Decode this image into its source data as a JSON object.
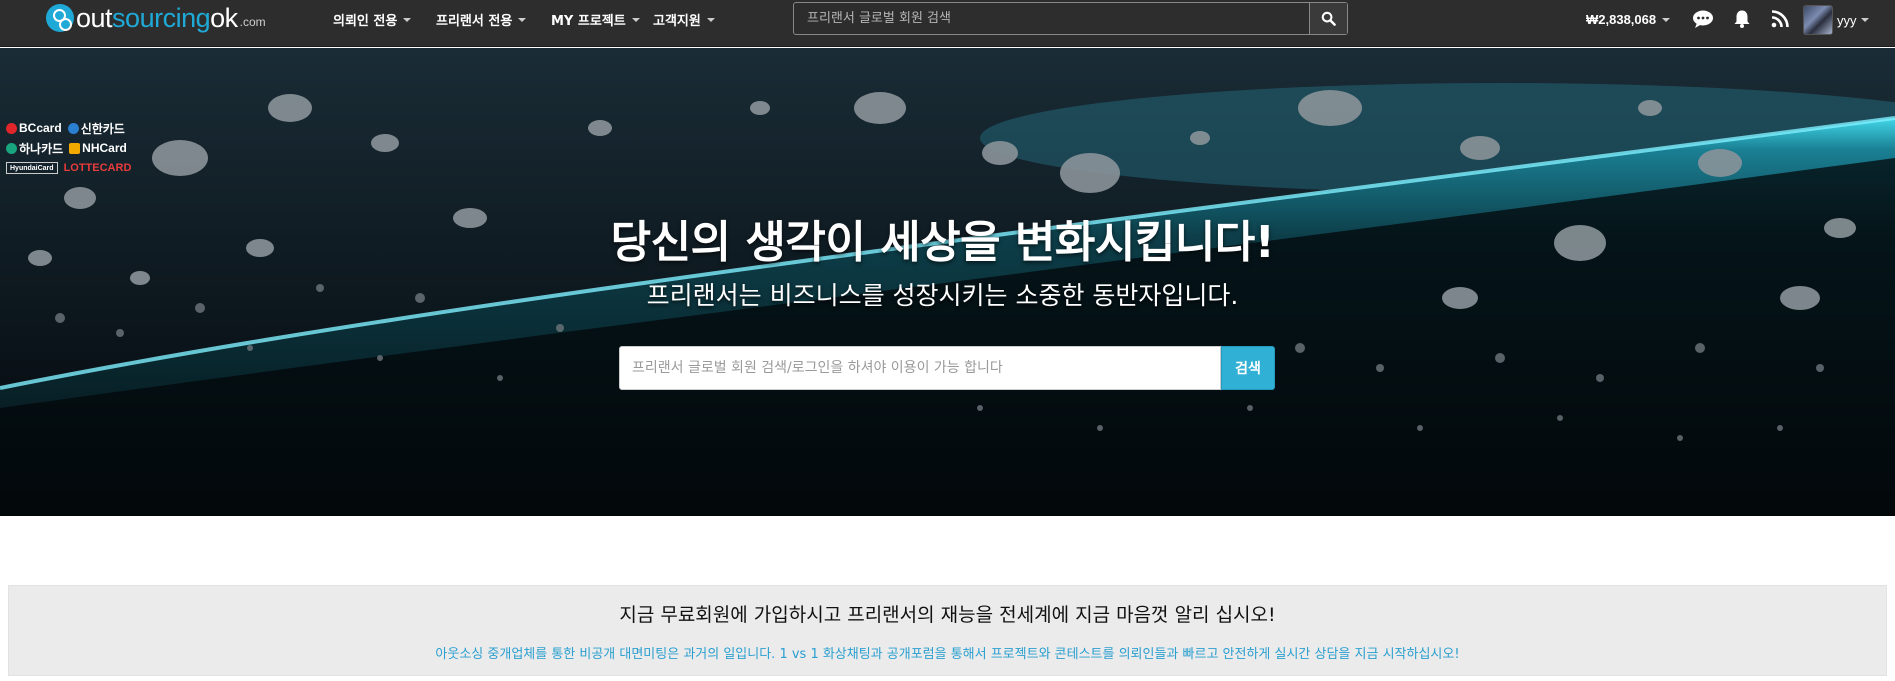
{
  "logo": {
    "part1": "out",
    "part2": "sourcing",
    "part3": "ok",
    "suffix": ".com"
  },
  "menu": [
    {
      "label": "의뢰인 전용"
    },
    {
      "label": "프리랜서 전용"
    },
    {
      "label": "MY 프로젝트"
    },
    {
      "label": "고객지원"
    }
  ],
  "nav_search": {
    "placeholder": "프리랜서 글로벌 회원 검색",
    "icon": "search-icon"
  },
  "balance": "₩2,838,068",
  "icons": [
    "chat-icon",
    "bell-icon",
    "rss-icon"
  ],
  "user": {
    "name": "yyy"
  },
  "cards": {
    "row1": [
      "BCcard",
      "신한카드"
    ],
    "row2": [
      "하나카드",
      "NHCard"
    ],
    "row3": [
      "HyundaiCard",
      "LOTTECARD"
    ]
  },
  "hero": {
    "title": "당신의 생각이 세상을 변화시킵니다!",
    "subtitle": "프리랜서는 비즈니스를 성장시키는 소중한 동반자입니다.",
    "search_placeholder": "프리랜서 글로벌 회원 검색/로그인을 하셔야 이용이 가능 합니다",
    "search_button": "검색"
  },
  "promo": {
    "title": "지금 무료회원에 가입하시고 프리랜서의 재능을 전세계에 지금 마음껏 알리 십시오!",
    "subtitle": "아웃소싱 중개업체를 통한 비공개 대면미팅은 과거의 일입니다. 1 vs 1 화상채팅과 공개포럼을 통해서 프로젝트와 콘테스트를 의뢰인들과 빠르고 안전하게 실시간 상담을 지금 시작하십시오!"
  },
  "colors": {
    "accent": "#31b0d5",
    "navbar": "#2d2d2d",
    "promo_text": "#2a9fd0"
  }
}
